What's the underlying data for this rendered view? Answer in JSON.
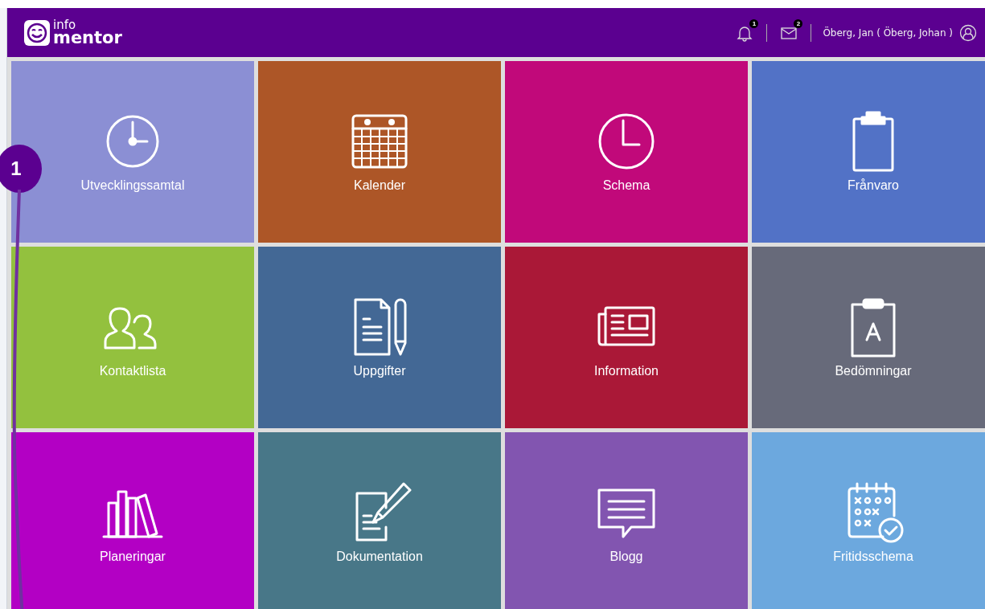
{
  "header": {
    "logo_top": "info",
    "logo_bottom": "mentor",
    "notifications": {
      "count": "1"
    },
    "messages": {
      "count": "2"
    },
    "user": "Öberg, Jan ( Öberg, Johan )"
  },
  "tiles": [
    {
      "label": "Utvecklingssamtal",
      "color": "#8b8fd4",
      "kind": "clock-hand"
    },
    {
      "label": "Kalender",
      "color": "#ad5627",
      "kind": "calendar"
    },
    {
      "label": "Schema",
      "color": "#c1097a",
      "kind": "clock"
    },
    {
      "label": "Frånvaro",
      "color": "#5272c6",
      "kind": "clipboard"
    },
    {
      "label": "Kontaktlista",
      "color": "#93c13e",
      "kind": "people"
    },
    {
      "label": "Uppgifter",
      "color": "#436895",
      "kind": "document-pen"
    },
    {
      "label": "Information",
      "color": "#aa1837",
      "kind": "newspaper"
    },
    {
      "label": "Bedömningar",
      "color": "#676a7a",
      "kind": "clipboard-letter"
    },
    {
      "label": "Planeringar",
      "color": "#b300c4",
      "kind": "books"
    },
    {
      "label": "Dokumentation",
      "color": "#487788",
      "kind": "note-pen"
    },
    {
      "label": "Blogg",
      "color": "#8255b0",
      "kind": "speech"
    },
    {
      "label": "Fritidsschema",
      "color": "#6ca8de",
      "kind": "schedule-check"
    }
  ],
  "annotation": {
    "label": "1"
  }
}
